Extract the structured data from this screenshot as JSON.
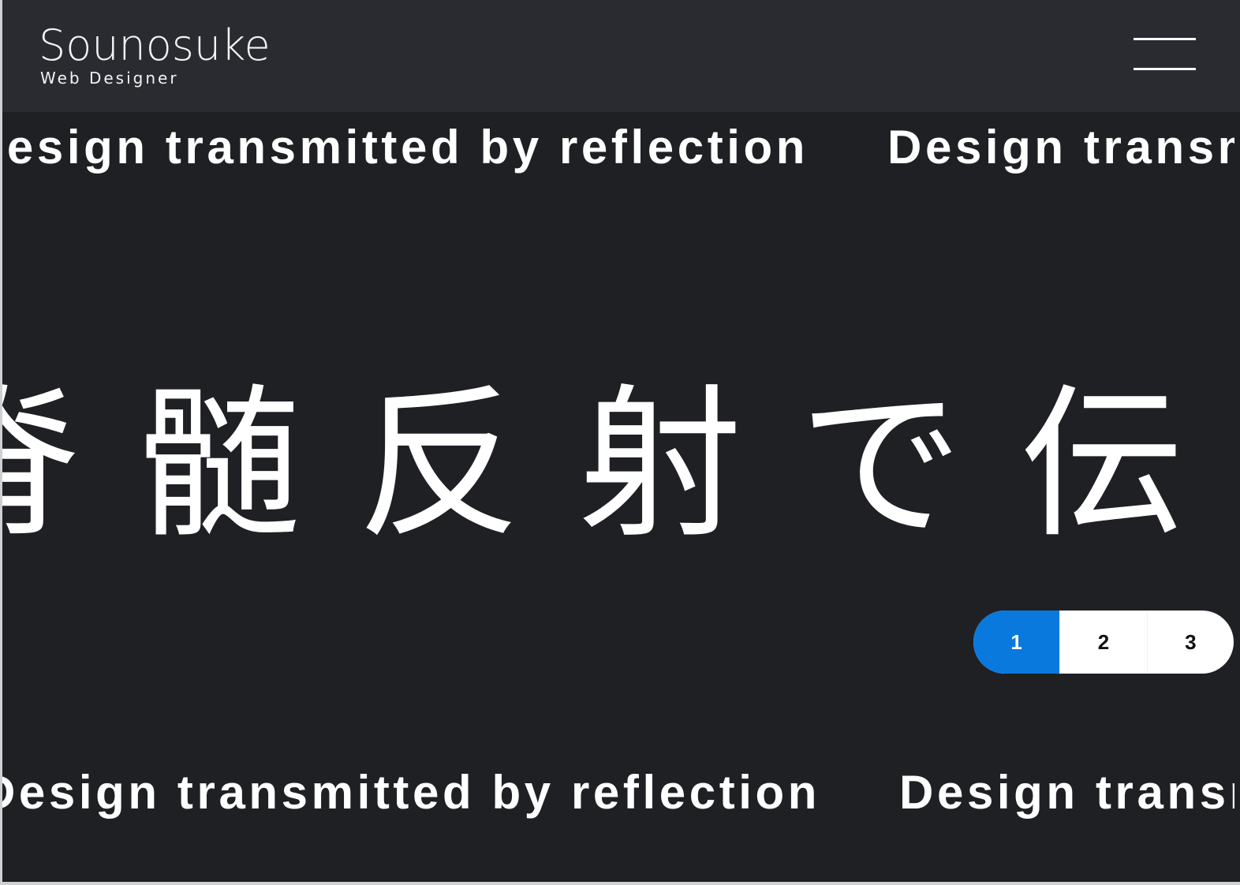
{
  "header": {
    "logo_name": "Sounosuke",
    "logo_subtitle": "Web Designer"
  },
  "marquee": {
    "text": "Design transmitted by reflection"
  },
  "hero": {
    "title": "脊髄反射で伝"
  },
  "pager": {
    "items": [
      "1",
      "2",
      "3"
    ],
    "active_index": 0
  },
  "colors": {
    "background": "#1f2024",
    "header_background": "#2a2b30",
    "accent": "#0a79de",
    "text": "#ffffff"
  }
}
